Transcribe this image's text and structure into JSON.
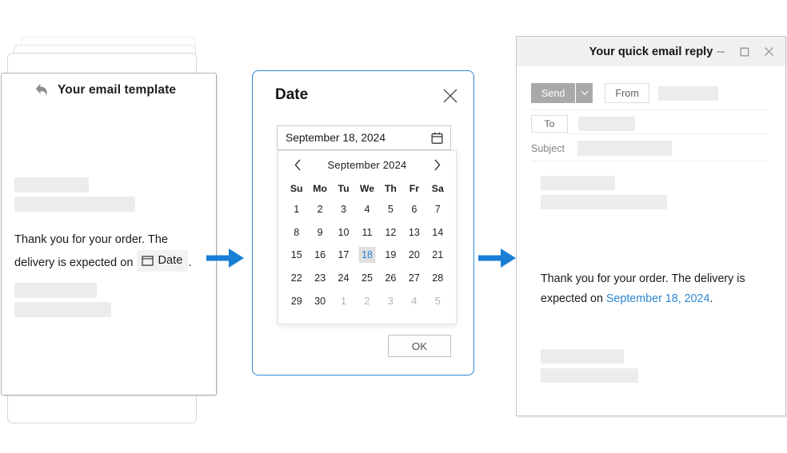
{
  "template_card": {
    "icon": "reply-arrow-icon",
    "title": "Your email template",
    "body_before": "Thank you for your order. The delivery is expected on",
    "date_chip": {
      "icon": "date-field-icon",
      "label": "Date"
    },
    "body_after": "."
  },
  "arrows": {
    "color": "#1a7fd4",
    "first": "flow-arrow-1",
    "second": "flow-arrow-2"
  },
  "date_dialog": {
    "title": "Date",
    "close_icon": "close-icon",
    "input": {
      "value": "September 18, 2024",
      "icon": "calendar-icon"
    },
    "calendar": {
      "prev_icon": "chevron-left-icon",
      "next_icon": "chevron-right-icon",
      "month": "September",
      "year": "2024",
      "month_year": "September 2024",
      "weekdays": [
        "Su",
        "Mo",
        "Tu",
        "We",
        "Th",
        "Fr",
        "Sa"
      ],
      "weeks": [
        [
          {
            "d": "1",
            "muted": false
          },
          {
            "d": "2",
            "muted": false
          },
          {
            "d": "3",
            "muted": false
          },
          {
            "d": "4",
            "muted": false
          },
          {
            "d": "5",
            "muted": false
          },
          {
            "d": "6",
            "muted": false
          },
          {
            "d": "7",
            "muted": false
          }
        ],
        [
          {
            "d": "8",
            "muted": false
          },
          {
            "d": "9",
            "muted": false
          },
          {
            "d": "10",
            "muted": false
          },
          {
            "d": "11",
            "muted": false
          },
          {
            "d": "12",
            "muted": false
          },
          {
            "d": "13",
            "muted": false
          },
          {
            "d": "14",
            "muted": false
          }
        ],
        [
          {
            "d": "15",
            "muted": false
          },
          {
            "d": "16",
            "muted": false
          },
          {
            "d": "17",
            "muted": false
          },
          {
            "d": "18",
            "muted": false,
            "selected": true
          },
          {
            "d": "19",
            "muted": false
          },
          {
            "d": "20",
            "muted": false
          },
          {
            "d": "21",
            "muted": false
          }
        ],
        [
          {
            "d": "22",
            "muted": false
          },
          {
            "d": "23",
            "muted": false
          },
          {
            "d": "24",
            "muted": false
          },
          {
            "d": "25",
            "muted": false
          },
          {
            "d": "26",
            "muted": false
          },
          {
            "d": "27",
            "muted": false
          },
          {
            "d": "28",
            "muted": false
          }
        ],
        [
          {
            "d": "29",
            "muted": false
          },
          {
            "d": "30",
            "muted": false
          },
          {
            "d": "1",
            "muted": true
          },
          {
            "d": "2",
            "muted": true
          },
          {
            "d": "3",
            "muted": true
          },
          {
            "d": "4",
            "muted": true
          },
          {
            "d": "5",
            "muted": true
          }
        ]
      ],
      "selected_day": "18",
      "cursor": "hand-pointer-cursor"
    },
    "ok_label": "OK",
    "accent_color": "#2b8ad9"
  },
  "email_window": {
    "title": "Your quick email reply",
    "controls": {
      "minimize": "minimize-icon",
      "maximize": "maximize-icon",
      "close": "close-icon"
    },
    "compose": {
      "send_label": "Send",
      "send_dropdown_icon": "chevron-down-icon",
      "from_label": "From",
      "to_label": "To",
      "subject_label": "Subject"
    },
    "body_before": "Thank you for your order. The delivery is expected on",
    "date_value": "September 18, 2024",
    "body_after": ".",
    "link_color": "#2e86d5"
  }
}
